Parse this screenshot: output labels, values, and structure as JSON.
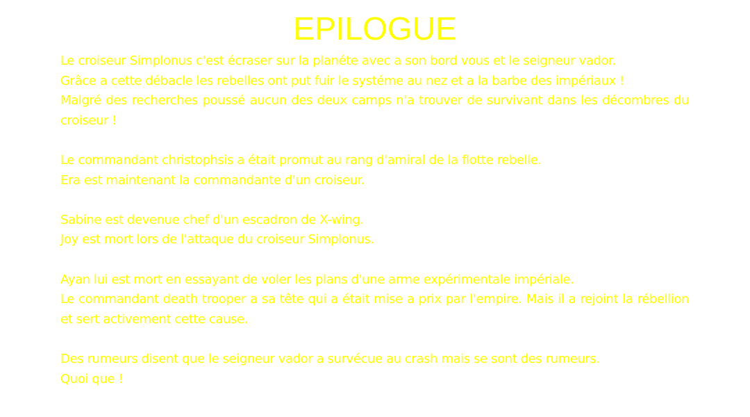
{
  "title": "EPILOGUE",
  "paragraphs": [
    {
      "lines": [
        "Le croiseur Simplonus c'est écraser sur la planéte avec a son bord vous et le seigneur vador.",
        "Grâce a cette débacle les rebelles ont put fuir le systéme au nez et a la barbe des impériaux !",
        "Malgré des recherches poussé aucun des deux camps n'a trouver de survivant dans les décombres du croiseur !"
      ]
    },
    {
      "lines": [
        "Le commandant christophsis a était promut au rang d'amiral de la flotte rebelle.",
        "Era est maintenant la commandante d'un croiseur."
      ]
    },
    {
      "lines": [
        "Sabine est devenue chef d'un escadron de X-wing.",
        "Joy  est mort lors de l'attaque du croiseur Simplonus."
      ]
    },
    {
      "lines": [
        "Ayan lui est mort en essayant de voler les plans d'une arme expérimentale impériale.",
        "Le commandant death trooper a sa tête qui a était mise a prix par l'empire. Mais il a rejoint la rébellion et sert activement cette cause."
      ]
    },
    {
      "lines": [
        "Des rumeurs disent que le seigneur vador a survécue au crash mais se sont des rumeurs.",
        "Quoi que !"
      ]
    }
  ],
  "colors": {
    "text": "#ffff00",
    "background": "#ffffff"
  }
}
